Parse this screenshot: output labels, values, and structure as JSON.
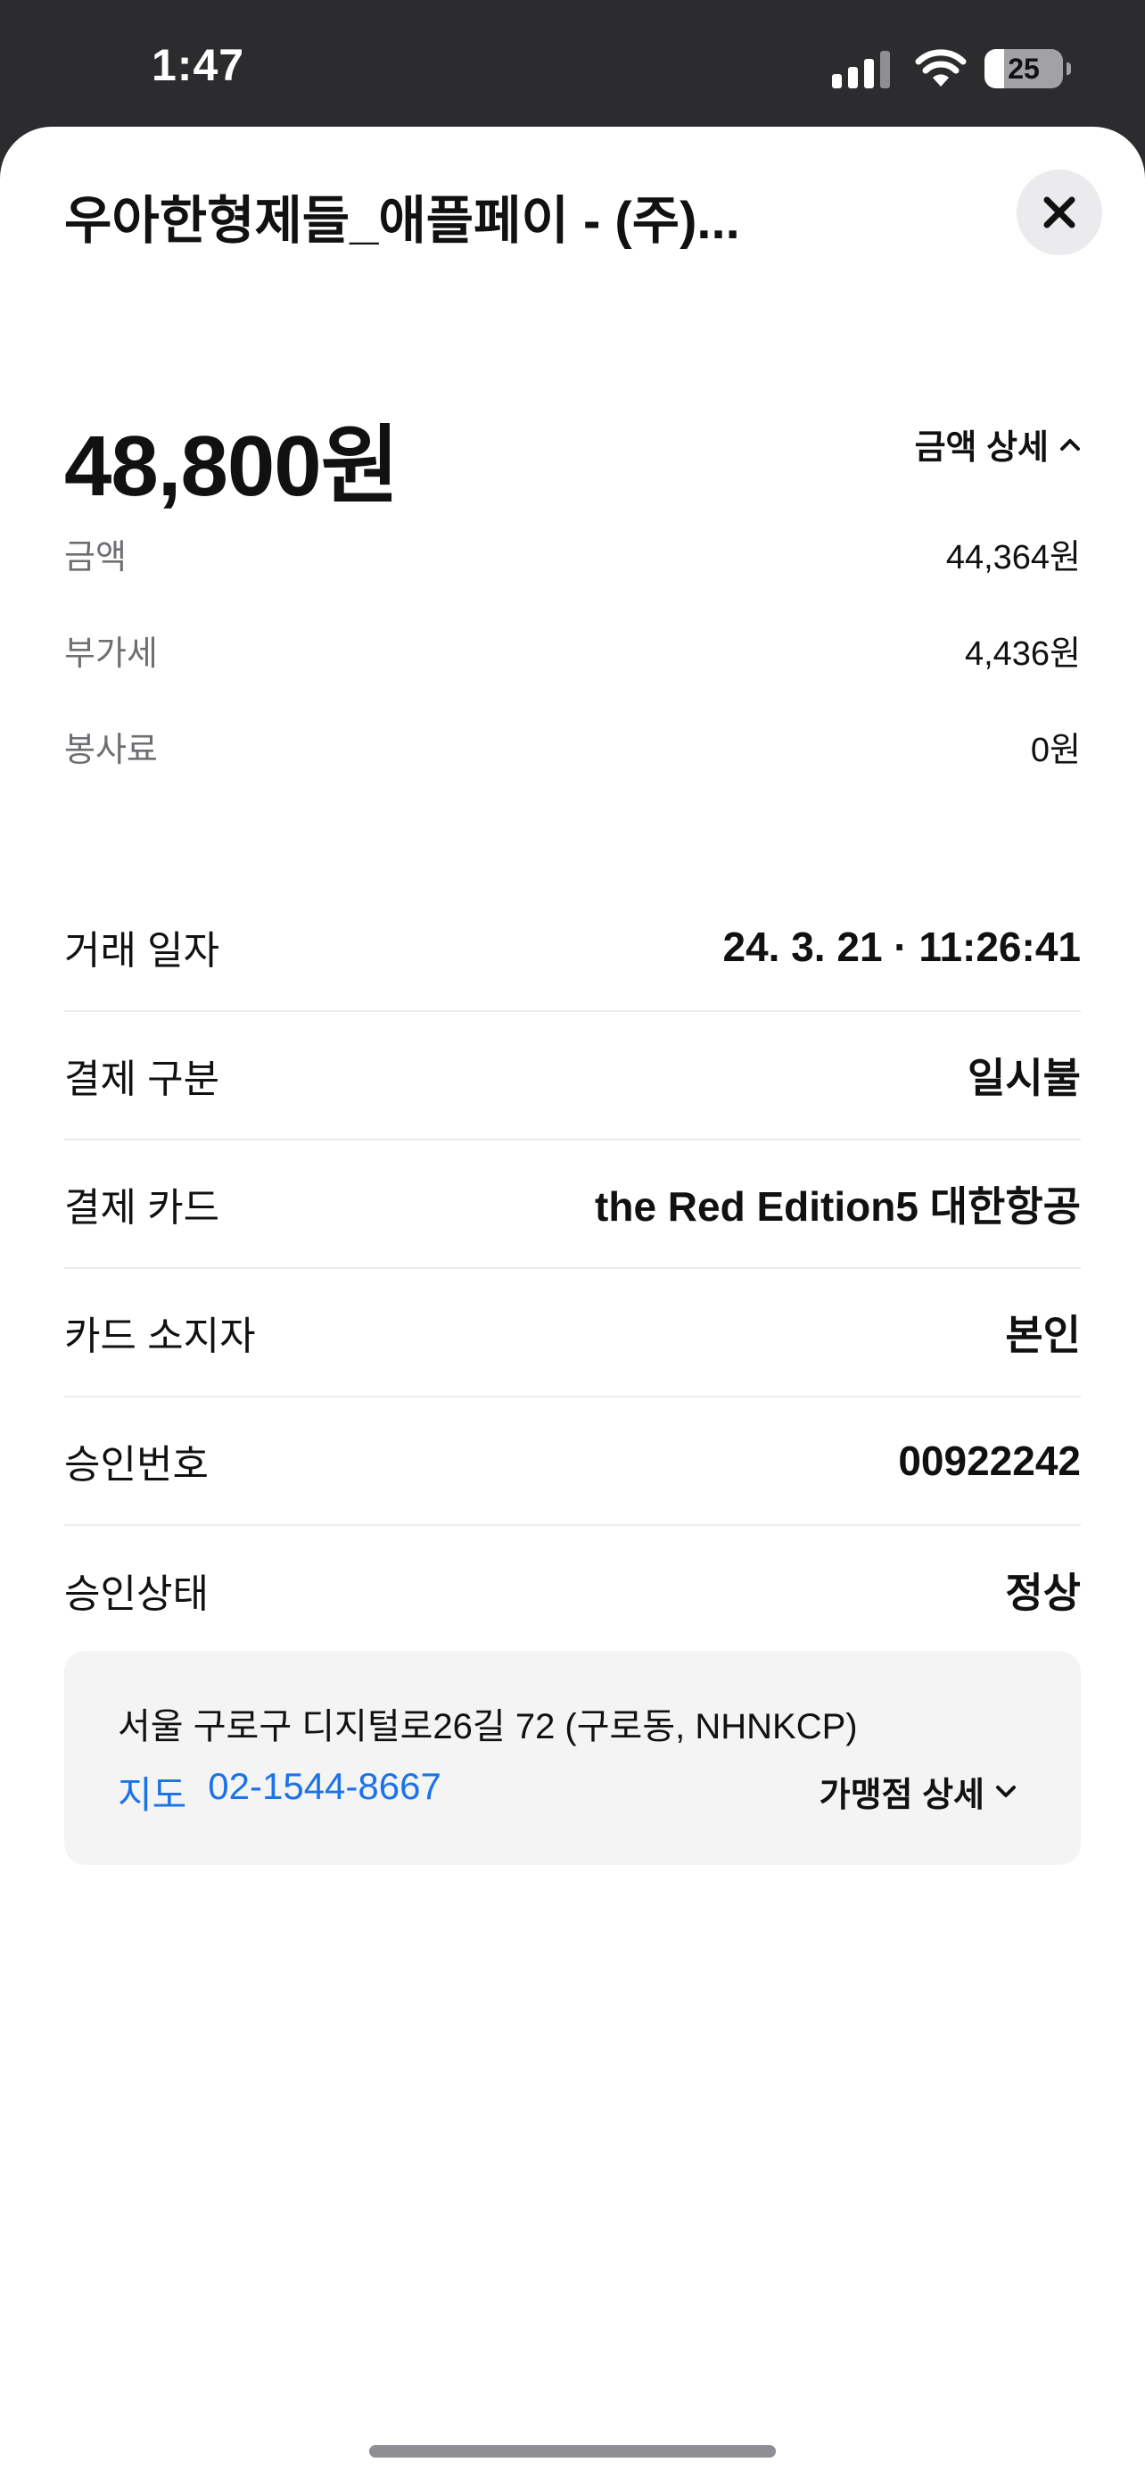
{
  "status_bar": {
    "time": "1:47",
    "battery": "25",
    "battery_level": 0.25
  },
  "header": {
    "title": "우아한형제들_애플페이 - (주)..."
  },
  "amount": {
    "total": "48,800원",
    "detail_toggle_label": "금액 상세",
    "breakdown": [
      {
        "label": "금액",
        "value": "44,364원"
      },
      {
        "label": "부가세",
        "value": "4,436원"
      },
      {
        "label": "봉사료",
        "value": "0원"
      }
    ]
  },
  "transaction": [
    {
      "label": "거래 일자",
      "value": "24. 3. 21 · 11:26:41"
    },
    {
      "label": "결제 구분",
      "value": "일시불"
    },
    {
      "label": "결제 카드",
      "value": "the Red Edition5 대한항공"
    },
    {
      "label": "카드 소지자",
      "value": "본인"
    },
    {
      "label": "승인번호",
      "value": "00922242"
    },
    {
      "label": "승인상태",
      "value": "정상"
    }
  ],
  "merchant": {
    "address": "서울 구로구 디지털로26길 72 (구로동, NHNKCP)",
    "map_label": "지도",
    "phone": "02-1544-8667",
    "detail_label": "가맹점 상세"
  }
}
